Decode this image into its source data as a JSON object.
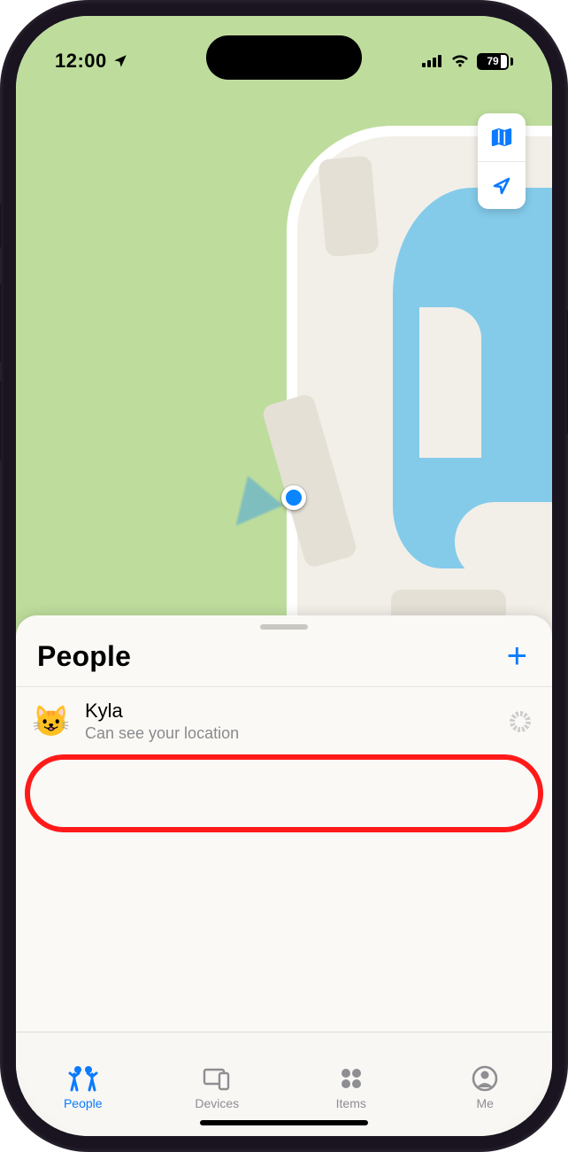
{
  "status": {
    "time": "12:00",
    "battery": "79"
  },
  "sheet": {
    "title": "People",
    "rows": [
      {
        "avatar": "😺",
        "name": "Kyla",
        "subtitle": "Can see your location"
      }
    ]
  },
  "tabs": {
    "people": "People",
    "devices": "Devices",
    "items": "Items",
    "me": "Me"
  }
}
